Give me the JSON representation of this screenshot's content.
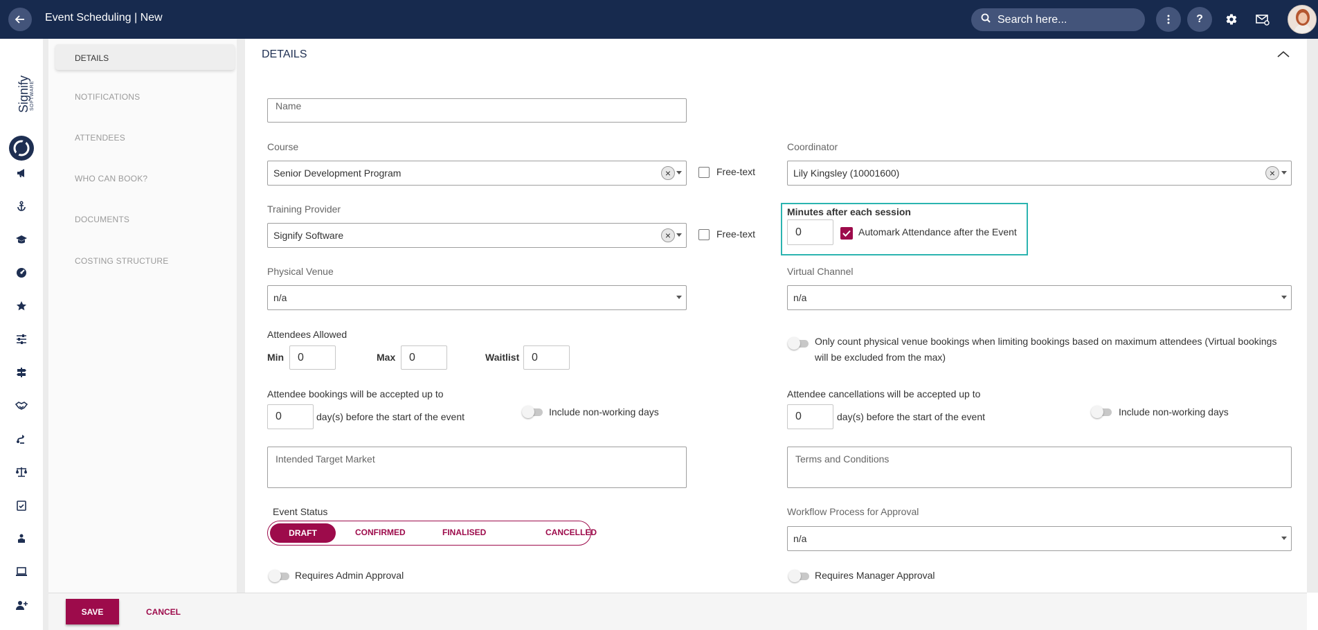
{
  "header": {
    "title": "Event Scheduling | New",
    "search_placeholder": "Search here...",
    "help_label": "?"
  },
  "brand": {
    "name": "Signify",
    "sub": "SOFTWARE"
  },
  "rail_icons": [
    "megaphone-icon",
    "anchor-icon",
    "graduation-cap-icon",
    "dashboard-icon",
    "star-icon",
    "sliders-icon",
    "signpost-icon",
    "handshake-icon",
    "route-icon",
    "scales-icon",
    "clipboard-check-icon",
    "person-desk-icon",
    "laptop-icon",
    "user-plus-icon"
  ],
  "subnav": {
    "items": [
      "DETAILS",
      "NOTIFICATIONS",
      "ATTENDEES",
      "WHO CAN BOOK?",
      "DOCUMENTS",
      "COSTING STRUCTURE"
    ]
  },
  "main": {
    "section_title": "DETAILS",
    "name_placeholder": "Name",
    "course": {
      "label": "Course",
      "value": "Senior Development Program",
      "freetext_label": "Free-text"
    },
    "coordinator": {
      "label": "Coordinator",
      "value": "Lily Kingsley (10001600)"
    },
    "training_provider": {
      "label": "Training Provider",
      "value": "Signify Software",
      "freetext_label": "Free-text"
    },
    "minutes": {
      "label": "Minutes after each session",
      "value": "0",
      "automark_label": "Automark Attendance after the Event"
    },
    "physical_venue": {
      "label": "Physical Venue",
      "value": "n/a"
    },
    "virtual_channel": {
      "label": "Virtual Channel",
      "value": "n/a"
    },
    "attendees": {
      "label": "Attendees Allowed",
      "min_label": "Min",
      "min_value": "0",
      "max_label": "Max",
      "max_value": "0",
      "waitlist_label": "Waitlist",
      "waitlist_value": "0"
    },
    "only_count_label": "Only count physical venue bookings when limiting bookings based on maximum attendees (Virtual bookings will be excluded from the max)",
    "bookings": {
      "label": "Attendee bookings will be accepted up to",
      "value": "0",
      "suffix": "day(s) before the start of the event",
      "toggle_label": "Include non-working days"
    },
    "cancellations": {
      "label": "Attendee cancellations will be accepted up to",
      "value": "0",
      "suffix": "day(s) before the start of the event",
      "toggle_label": "Include non-working days"
    },
    "target_market_placeholder": "Intended Target Market",
    "terms_placeholder": "Terms and Conditions",
    "event_status": {
      "label": "Event Status",
      "options": [
        "DRAFT",
        "CONFIRMED",
        "FINALISED",
        "CANCELLED"
      ],
      "selected": "DRAFT"
    },
    "workflow": {
      "label": "Workflow Process for Approval",
      "value": "n/a"
    },
    "requires_admin_label": "Requires Admin Approval",
    "requires_manager_label": "Requires Manager Approval"
  },
  "footer": {
    "save_label": "SAVE",
    "cancel_label": "CANCEL"
  },
  "colors": {
    "header_bg": "#172a4e",
    "accent": "#9d0b4b",
    "highlight": "#2bb4b0"
  }
}
